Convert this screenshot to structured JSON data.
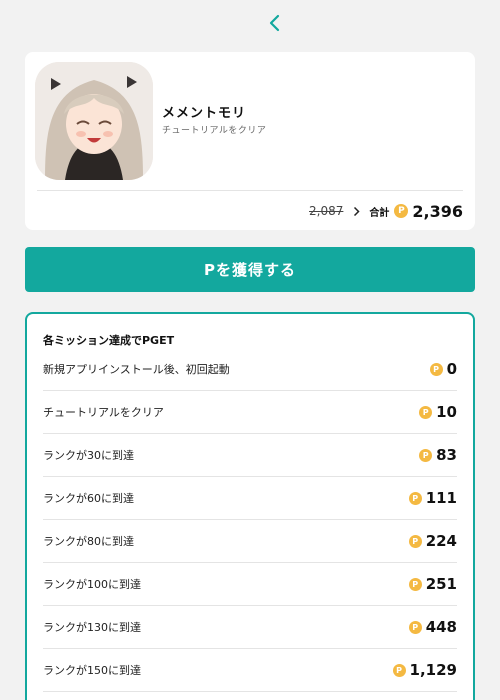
{
  "nav": {
    "back_icon": "chevron-left-icon"
  },
  "app": {
    "name": "メメントモリ",
    "status": "チュートリアルをクリア",
    "old_points": "2,087",
    "total_label": "合計",
    "total_points": "2,396",
    "coin_symbol": "P"
  },
  "cta": {
    "label": "Pを獲得する"
  },
  "missions": {
    "title": "各ミッション達成でPGET",
    "items": [
      {
        "label": "新規アプリインストール後、初回起動",
        "points": "0"
      },
      {
        "label": "チュートリアルをクリア",
        "points": "10"
      },
      {
        "label": "ランクが30に到達",
        "points": "83"
      },
      {
        "label": "ランクが60に到達",
        "points": "111"
      },
      {
        "label": "ランクが80に到達",
        "points": "224"
      },
      {
        "label": "ランクが100に到達",
        "points": "251"
      },
      {
        "label": "ランクが130に到達",
        "points": "448"
      },
      {
        "label": "ランクが150に到達",
        "points": "1,129"
      }
    ]
  },
  "colors": {
    "accent": "#13a89e",
    "coin": "#f4b942"
  }
}
